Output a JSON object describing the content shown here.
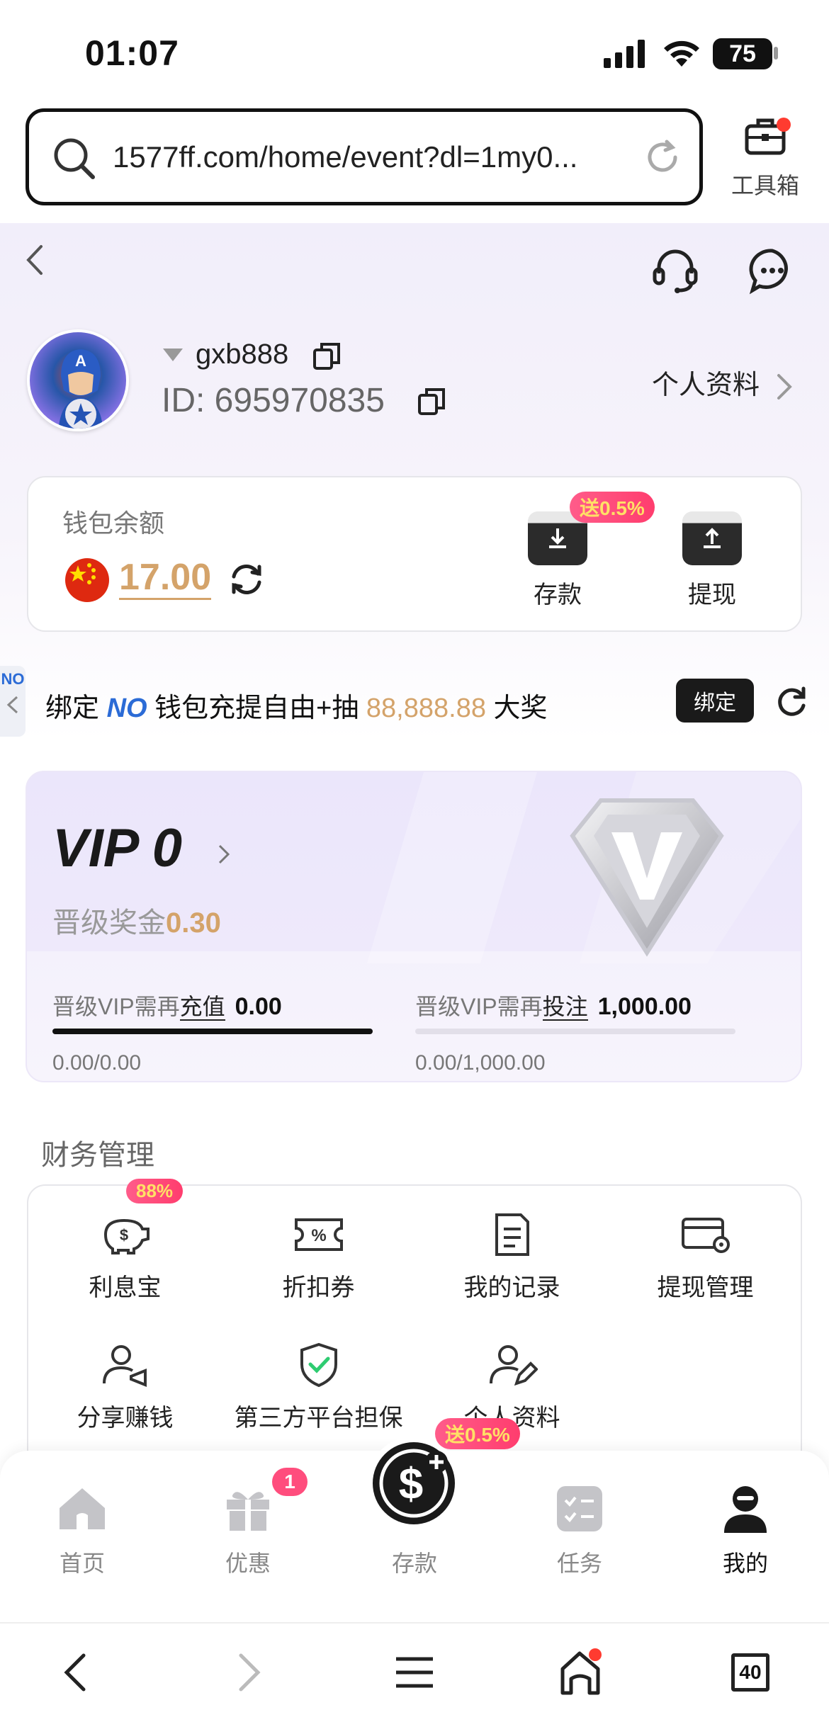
{
  "status": {
    "time": "01:07",
    "battery": "75"
  },
  "browser": {
    "url": "1577ff.com/home/event?dl=1my0...",
    "toolbox_label": "工具箱",
    "tabs_count": "40"
  },
  "user": {
    "name": "gxb888",
    "id": "ID: 695970835",
    "profile_link": "个人资料"
  },
  "wallet": {
    "label": "钱包余额",
    "amount": "17.00",
    "deposit_label": "存款",
    "withdraw_label": "提现",
    "deposit_badge": "送0.5%"
  },
  "bind": {
    "prefix": "绑定",
    "brand": "NO",
    "mid": "钱包充提自由+抽",
    "amount": "88,888.88",
    "suffix": "大奖",
    "button": "绑定"
  },
  "vip": {
    "title": "VIP 0",
    "bonus_label": "晋级奖金",
    "bonus_value": "0.30",
    "recharge": {
      "label": "晋级VIP需再",
      "action": "充值",
      "value": "0.00",
      "progress": "0.00/0.00",
      "fraction": 1.0
    },
    "bet": {
      "label": "晋级VIP需再",
      "action": "投注",
      "value": "1,000.00",
      "progress": "0.00/1,000.00",
      "fraction": 0.0
    }
  },
  "finance": {
    "title": "财务管理",
    "items": [
      {
        "label": "利息宝",
        "icon": "piggy-bank-icon",
        "badge": "88%"
      },
      {
        "label": "折扣券",
        "icon": "coupon-icon"
      },
      {
        "label": "我的记录",
        "icon": "document-icon"
      },
      {
        "label": "提现管理",
        "icon": "card-settings-icon"
      },
      {
        "label": "分享赚钱",
        "icon": "share-user-icon"
      },
      {
        "label": "第三方平台担保",
        "icon": "shield-check-icon"
      },
      {
        "label": "个人资料",
        "icon": "user-edit-icon"
      }
    ]
  },
  "tabbar": {
    "items": [
      {
        "label": "首页",
        "icon": "home-icon"
      },
      {
        "label": "优惠",
        "icon": "gift-icon",
        "badge": "1"
      },
      {
        "label": "存款",
        "icon": "deposit-coin-icon",
        "badge": "送0.5%"
      },
      {
        "label": "任务",
        "icon": "task-icon"
      },
      {
        "label": "我的",
        "icon": "profile-icon"
      }
    ]
  }
}
